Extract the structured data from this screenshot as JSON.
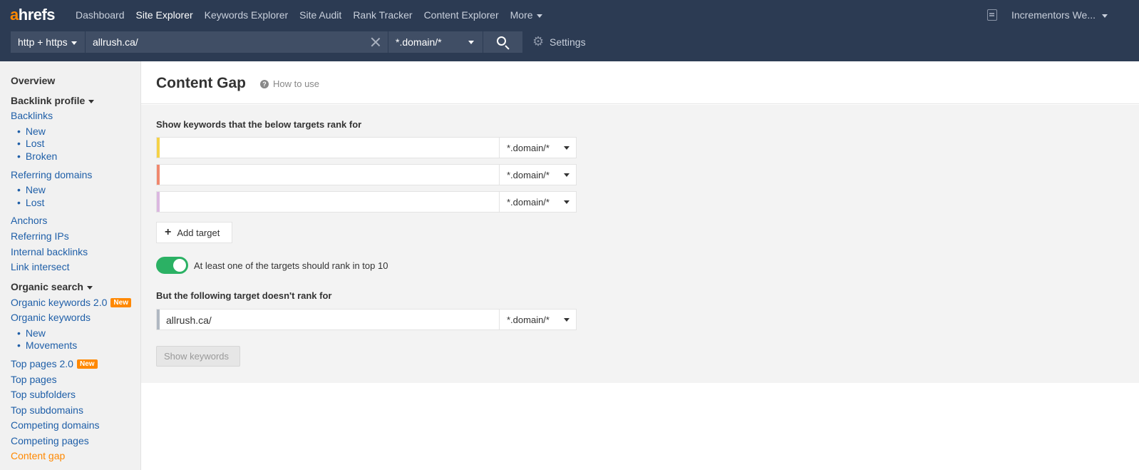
{
  "logo": {
    "a": "a",
    "rest": "hrefs"
  },
  "nav": {
    "items": [
      {
        "label": "Dashboard",
        "active": false
      },
      {
        "label": "Site Explorer",
        "active": true
      },
      {
        "label": "Keywords Explorer",
        "active": false
      },
      {
        "label": "Site Audit",
        "active": false
      },
      {
        "label": "Rank Tracker",
        "active": false
      },
      {
        "label": "Content Explorer",
        "active": false
      }
    ],
    "more_label": "More",
    "account_label": "Incrementors We..."
  },
  "search": {
    "protocol": "http + https",
    "url": "allrush.ca/",
    "mode": "*.domain/*",
    "settings_label": "Settings"
  },
  "sidebar": {
    "overview": "Overview",
    "backlink_profile": "Backlink profile",
    "backlinks": "Backlinks",
    "backlinks_new": "New",
    "backlinks_lost": "Lost",
    "backlinks_broken": "Broken",
    "referring_domains": "Referring domains",
    "rd_new": "New",
    "rd_lost": "Lost",
    "anchors": "Anchors",
    "referring_ips": "Referring IPs",
    "internal_backlinks": "Internal backlinks",
    "link_intersect": "Link intersect",
    "organic_search": "Organic search",
    "organic_keywords_2": "Organic keywords 2.0",
    "organic_keywords": "Organic keywords",
    "ok_new": "New",
    "ok_movements": "Movements",
    "top_pages_2": "Top pages 2.0",
    "top_pages": "Top pages",
    "top_subfolders": "Top subfolders",
    "top_subdomains": "Top subdomains",
    "competing_domains": "Competing domains",
    "competing_pages": "Competing pages",
    "content_gap": "Content gap",
    "badge_new": "New"
  },
  "main": {
    "title": "Content Gap",
    "how_to_use": "How to use",
    "show_label": "Show keywords that the below targets rank for",
    "targets": [
      {
        "value": "",
        "mode": "*.domain/*",
        "color": "#f5d247"
      },
      {
        "value": "",
        "mode": "*.domain/*",
        "color": "#f0886e"
      },
      {
        "value": "",
        "mode": "*.domain/*",
        "color": "#dbb8e0"
      }
    ],
    "add_target": "Add target",
    "toggle_on": true,
    "toggle_label": "At least one of the targets should rank in top 10",
    "but_label": "But the following target doesn't rank for",
    "exclude": {
      "value": "allrush.ca/",
      "mode": "*.domain/*",
      "color": "#b0b8c2"
    },
    "show_button": "Show keywords"
  }
}
